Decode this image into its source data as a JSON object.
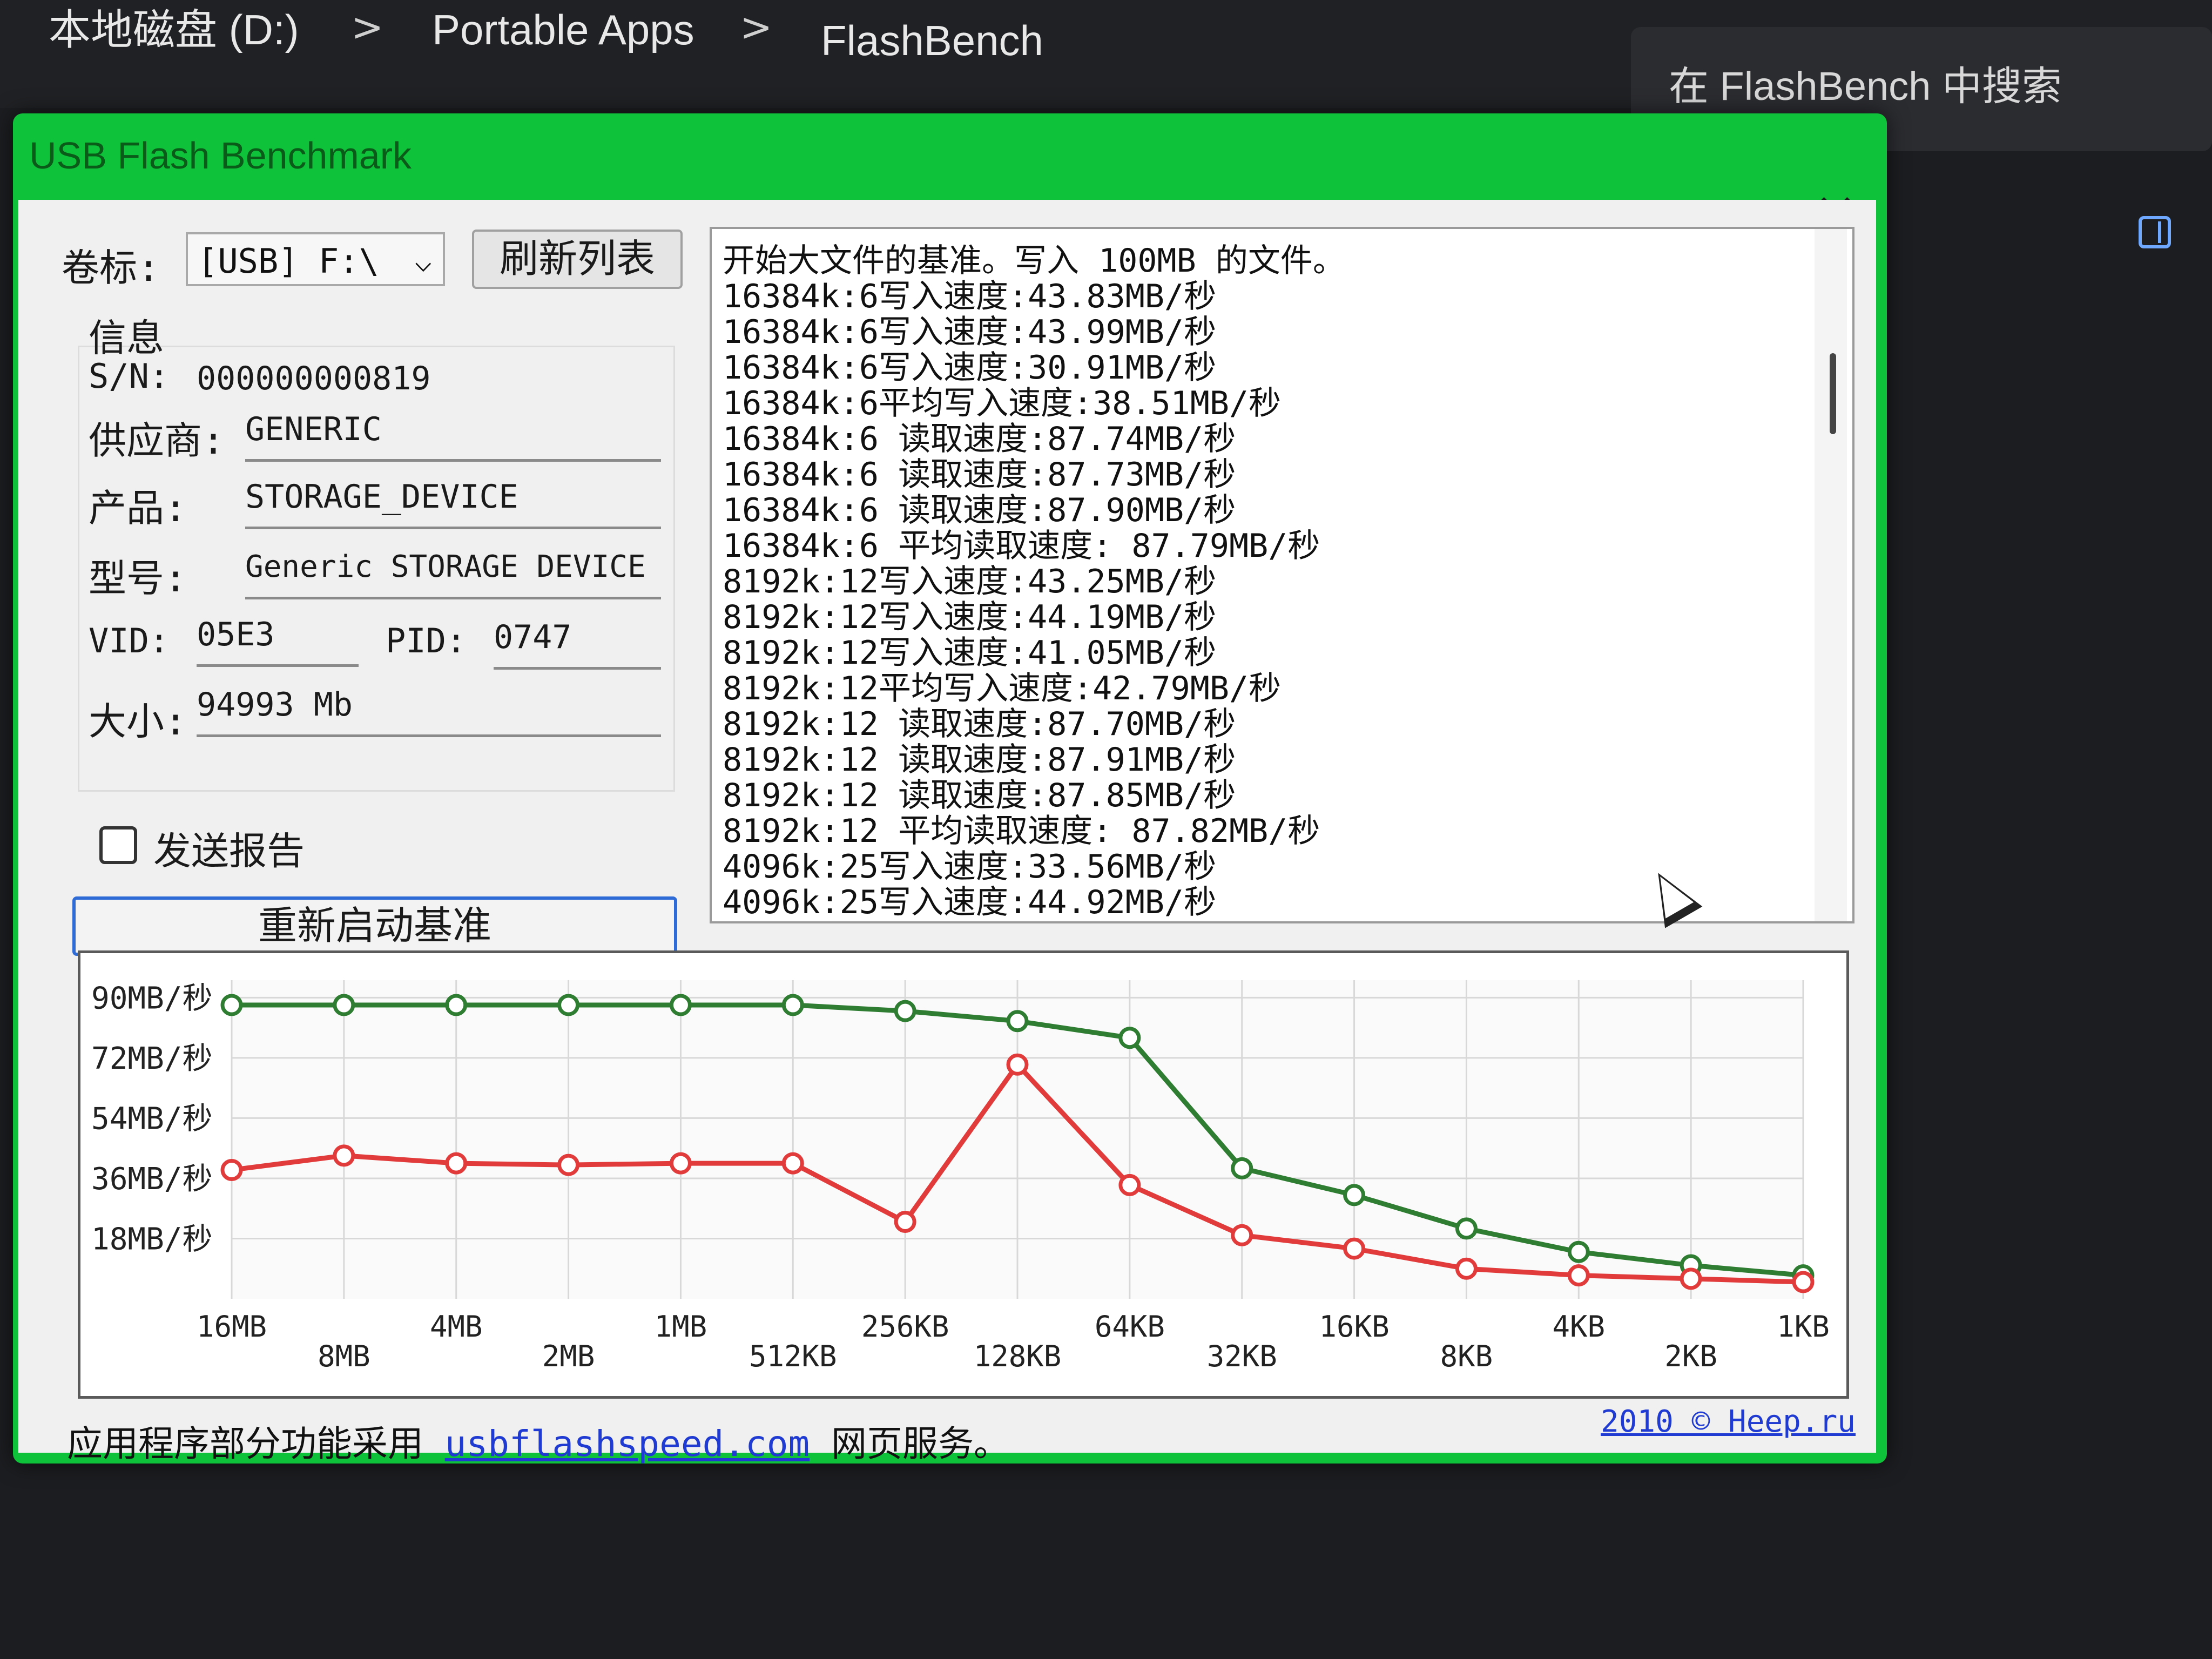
{
  "explorer": {
    "breadcrumb": [
      "本地磁盘 (D:)",
      "Portable Apps",
      "FlashBench"
    ],
    "separator": ">",
    "search_placeholder": "在 FlashBench 中搜索"
  },
  "dialog": {
    "title": "USB Flash Benchmark",
    "close_glyph": "✕",
    "volume_label": "卷标:",
    "volume_value": "[USB] F:\\",
    "refresh_button": "刷新列表",
    "info_heading": "信息",
    "sn_label": "S/N:",
    "sn_value": "000000000819",
    "vendor_label": "供应商:",
    "vendor_value": "GENERIC",
    "product_label": "产品:",
    "product_value": "STORAGE_DEVICE",
    "model_label": "型号:",
    "model_value": "Generic STORAGE DEVICE",
    "vid_label": "VID:",
    "vid_value": "05E3",
    "pid_label": "PID:",
    "pid_value": "0747",
    "size_label": "大小:",
    "size_value": "94993 Mb",
    "send_report_label": "发送报告",
    "send_report_checked": false,
    "restart_button": "重新启动基准",
    "log_lines": [
      "开始大文件的基准。写入 100MB 的文件。",
      "16384k:6写入速度:43.83MB/秒",
      "16384k:6写入速度:43.99MB/秒",
      "16384k:6写入速度:30.91MB/秒",
      "16384k:6平均写入速度:38.51MB/秒",
      "16384k:6 读取速度:87.74MB/秒",
      "16384k:6 读取速度:87.73MB/秒",
      "16384k:6 读取速度:87.90MB/秒",
      "16384k:6 平均读取速度: 87.79MB/秒",
      "8192k:12写入速度:43.25MB/秒",
      "8192k:12写入速度:44.19MB/秒",
      "8192k:12写入速度:41.05MB/秒",
      "8192k:12平均写入速度:42.79MB/秒",
      "8192k:12 读取速度:87.70MB/秒",
      "8192k:12 读取速度:87.91MB/秒",
      "8192k:12 读取速度:87.85MB/秒",
      "8192k:12 平均读取速度: 87.82MB/秒",
      "4096k:25写入速度:33.56MB/秒",
      "4096k:25写入速度:44.92MB/秒"
    ],
    "footer_text": "应用程序部分功能采用",
    "footer_link": "usbflashspeed.com",
    "footer_suffix": "网页服务。",
    "copyright": "2010 © Heep.ru"
  },
  "chart_data": {
    "type": "line",
    "categories": [
      "16MB",
      "8MB",
      "4MB",
      "2MB",
      "1MB",
      "512KB",
      "256KB",
      "128KB",
      "64KB",
      "32KB",
      "16KB",
      "8KB",
      "4KB",
      "2KB",
      "1KB"
    ],
    "y_tick_labels": [
      "90MB/秒",
      "72MB/秒",
      "54MB/秒",
      "36MB/秒",
      "18MB/秒"
    ],
    "y_ticks": [
      90,
      72,
      54,
      36,
      18
    ],
    "ylim": [
      0,
      92
    ],
    "grid": true,
    "series": [
      {
        "color": "#2e7d32",
        "values": [
          87.8,
          87.8,
          87.8,
          87.8,
          87.8,
          87.8,
          86,
          83,
          78,
          39,
          31,
          21,
          14,
          10,
          7
        ]
      },
      {
        "color": "#e23b3b",
        "values": [
          38.5,
          42.8,
          40.5,
          40,
          40.5,
          40.5,
          23,
          70,
          34,
          19,
          15,
          9,
          7,
          6,
          5
        ]
      }
    ]
  }
}
